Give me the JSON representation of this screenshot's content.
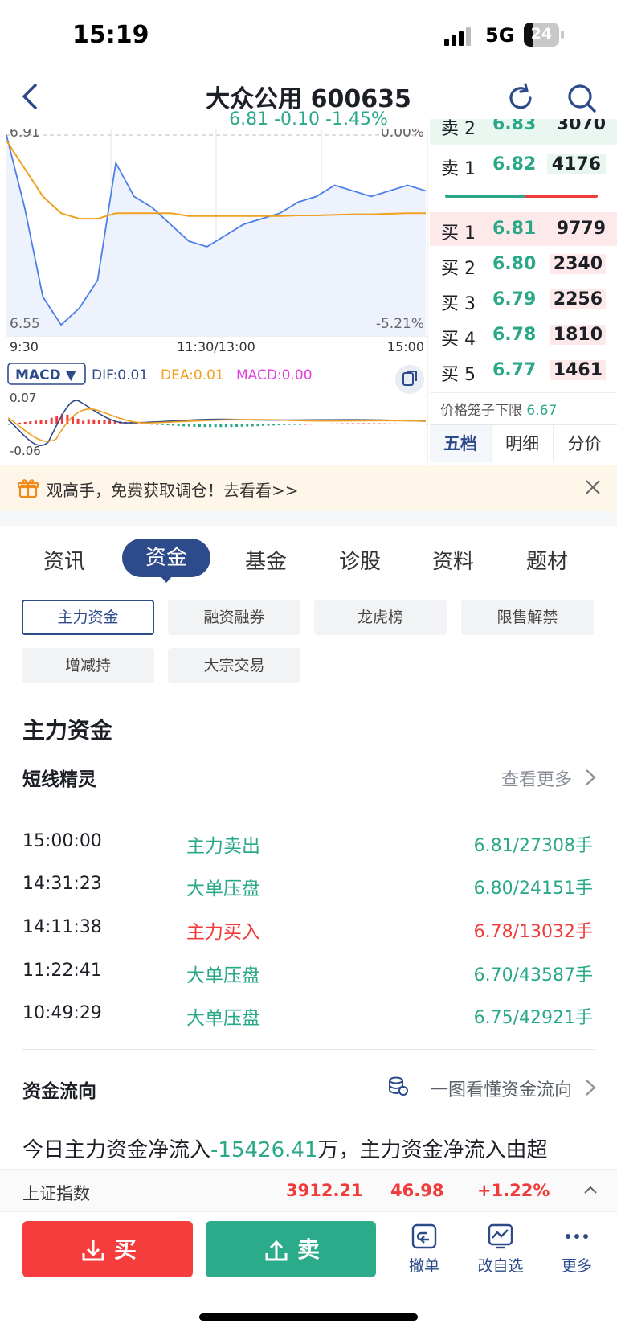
{
  "status": {
    "time": "15:19",
    "network": "5G",
    "battery": "24"
  },
  "header": {
    "title": "大众公用 600635",
    "quote": "6.81 -0.10 -1.45%"
  },
  "chart": {
    "price_high": "6.91",
    "price_low": "6.55",
    "pct_high": "0.00%",
    "pct_low": "-5.21%",
    "time_start": "9:30",
    "time_mid": "11:30/13:00",
    "time_end": "15:00",
    "macd_select": "MACD ▼",
    "dif": "DIF:0.01",
    "dea": "DEA:0.01",
    "macd": "MACD:0.00",
    "macd_high": "0.07",
    "macd_low": "-0.06",
    "colors": {
      "price": "#4a7ee8",
      "avg": "#f0a020",
      "up": "#f13a3a",
      "down": "#2aa888"
    }
  },
  "chart_data": {
    "type": "line",
    "title": "",
    "xlabel": "",
    "ylabel": "",
    "ylim": [
      6.55,
      6.91
    ],
    "x_ticks": [
      "9:30",
      "11:30/13:00",
      "15:00"
    ],
    "series": [
      {
        "name": "",
        "values": [
          6.91,
          6.78,
          6.62,
          6.57,
          6.6,
          6.65,
          6.86,
          6.8,
          6.78,
          6.75,
          6.72,
          6.71,
          6.73,
          6.75,
          6.76,
          6.77,
          6.79,
          6.8,
          6.82,
          6.81,
          6.8,
          6.81,
          6.82,
          6.81
        ]
      },
      {
        "name": "",
        "values": [
          6.9,
          6.85,
          6.8,
          6.77,
          6.76,
          6.76,
          6.77,
          6.77,
          6.77,
          6.77,
          6.765,
          6.765,
          6.765,
          6.765,
          6.765,
          6.765,
          6.766,
          6.766,
          6.767,
          6.768,
          6.768,
          6.769,
          6.77,
          6.77
        ]
      }
    ]
  },
  "orderbook": {
    "asks": [
      {
        "label": "卖 2",
        "price": "6.83",
        "vol": "3070"
      },
      {
        "label": "卖 1",
        "price": "6.82",
        "vol": "4176"
      }
    ],
    "bids": [
      {
        "label": "买 1",
        "price": "6.81",
        "vol": "9779"
      },
      {
        "label": "买 2",
        "price": "6.80",
        "vol": "2340"
      },
      {
        "label": "买 3",
        "price": "6.79",
        "vol": "2256"
      },
      {
        "label": "买 4",
        "price": "6.78",
        "vol": "1810"
      },
      {
        "label": "买 5",
        "price": "6.77",
        "vol": "1461"
      }
    ],
    "limit": "价格笼子下限",
    "limit_value": "6.67",
    "tabs": [
      "五档",
      "明细",
      "分价"
    ]
  },
  "promo": {
    "text": "观高手，免费获取调仓！去看看>>"
  },
  "tabs": [
    "资讯",
    "资金",
    "基金",
    "诊股",
    "资料",
    "题材"
  ],
  "chips": [
    "主力资金",
    "融资融券",
    "龙虎榜",
    "限售解禁",
    "增减持",
    "大宗交易"
  ],
  "section": {
    "title": "主力资金",
    "sub": "短线精灵",
    "more": "查看更多",
    "events": [
      {
        "time": "15:00:00",
        "type": "主力卖出",
        "val": "6.81/27308手",
        "dir": "down"
      },
      {
        "time": "14:31:23",
        "type": "大单压盘",
        "val": "6.80/24151手",
        "dir": "down"
      },
      {
        "time": "14:11:38",
        "type": "主力买入",
        "val": "6.78/13032手",
        "dir": "up"
      },
      {
        "time": "11:22:41",
        "type": "大单压盘",
        "val": "6.70/43587手",
        "dir": "down"
      },
      {
        "time": "10:49:29",
        "type": "大单压盘",
        "val": "6.75/42921手",
        "dir": "down"
      }
    ]
  },
  "flow": {
    "title": "资金流向",
    "link": "一图看懂资金流向",
    "text_pre": "今日主力资金净流入",
    "text_value": "-15426.41",
    "text_post": "万，主力资金净流入由超"
  },
  "index": {
    "name": "上证指数",
    "value": "3912.21",
    "change": "46.98",
    "pct": "+1.22%"
  },
  "actions": {
    "buy": "买",
    "sell": "卖",
    "cancel": "撤单",
    "watch": "改自选",
    "more": "更多"
  }
}
